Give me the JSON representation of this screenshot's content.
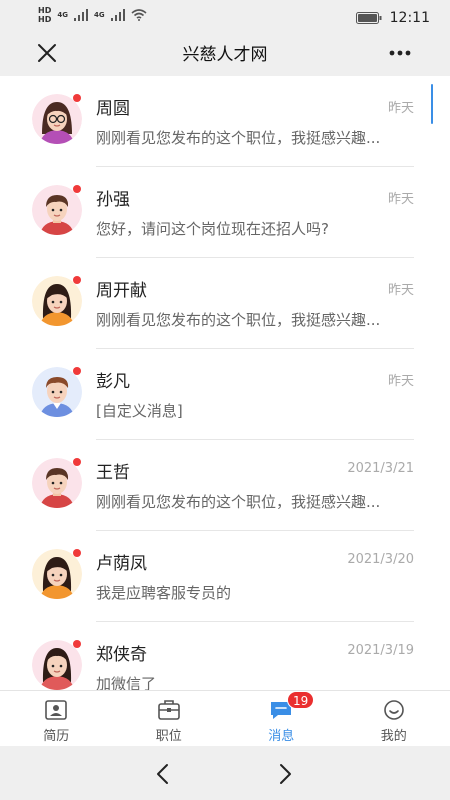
{
  "status_bar": {
    "hd_1": "HD",
    "hd_2": "HD",
    "net_1": "4G",
    "net_2": "4G",
    "time": "12:11"
  },
  "header": {
    "title": "兴慈人才网",
    "close_icon": "close-icon",
    "more_icon": "more-icon"
  },
  "conversations": [
    {
      "name": "周圆",
      "time": "昨天",
      "preview": "刚刚看见您发布的这个职位，我挺感兴趣...",
      "unread": true,
      "avatar": "woman-glasses"
    },
    {
      "name": "孙强",
      "time": "昨天",
      "preview": "您好，请问这个岗位现在还招人吗?",
      "unread": true,
      "avatar": "man-red"
    },
    {
      "name": "周开献",
      "time": "昨天",
      "preview": "刚刚看见您发布的这个职位，我挺感兴趣...",
      "unread": true,
      "avatar": "woman-orange"
    },
    {
      "name": "彭凡",
      "time": "昨天",
      "preview": "[自定义消息]",
      "unread": true,
      "avatar": "man-blue"
    },
    {
      "name": "王哲",
      "time": "2021/3/21",
      "preview": "刚刚看见您发布的这个职位，我挺感兴趣...",
      "unread": true,
      "avatar": "man-red"
    },
    {
      "name": "卢荫凤",
      "time": "2021/3/20",
      "preview": "我是应聘客服专员的",
      "unread": true,
      "avatar": "woman-orange"
    },
    {
      "name": "郑侠奇",
      "time": "2021/3/19",
      "preview": "加微信了",
      "unread": true,
      "avatar": "woman-red"
    }
  ],
  "tabs": [
    {
      "label": "简历",
      "icon": "resume-icon",
      "active": false
    },
    {
      "label": "职位",
      "icon": "briefcase-icon",
      "active": false
    },
    {
      "label": "消息",
      "icon": "message-icon",
      "active": true,
      "badge": "19"
    },
    {
      "label": "我的",
      "icon": "profile-icon",
      "active": false
    }
  ],
  "colors": {
    "accent": "#3a8ee6",
    "badge": "#ea2f2f",
    "unread_dot": "#f03a3a"
  }
}
